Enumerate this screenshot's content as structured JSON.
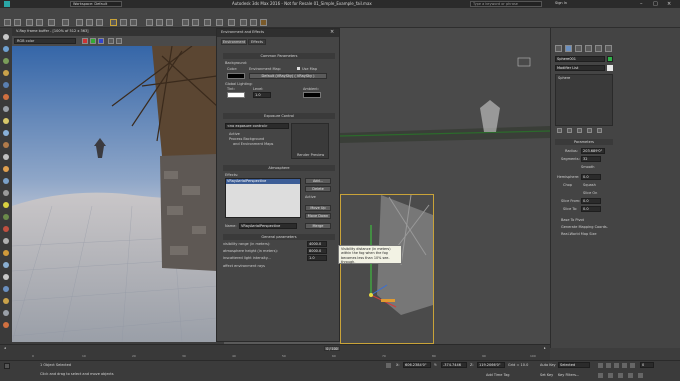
{
  "window": {
    "title": "Autodesk 3ds Max 2016 - Not for Resale    01_Simple_Example_fail.max",
    "workspace": "Workspace: Default",
    "search_placeholder": "Type a keyword or phrase",
    "signin": "Sign In"
  },
  "menu": [
    "Edit",
    "Tools",
    "Group",
    "Views",
    "Create",
    "Modifiers",
    "Animation",
    "Graph Editors",
    "Rendering",
    "Civil View",
    "Customize",
    "Scripting",
    "Help"
  ],
  "frame_buffer": {
    "title": "V-Ray frame buffer - [100% of 512 x 363]",
    "channel": "RGB color"
  },
  "env_dialog": {
    "title": "Environment and Effects",
    "tabs": [
      "Environment",
      "Effects"
    ],
    "common_params": "Common Parameters",
    "background": "Background:",
    "color": "Color:",
    "env_map": "Environment Map:",
    "use_map": "Use Map",
    "map_name": "Default (VRaySky) ( VRaySky )",
    "global_lighting": "Global Lighting:",
    "tint": "Tint:",
    "level": "Level:",
    "level_value": "1.0",
    "ambient": "Ambient:",
    "exposure_hdr": "Exposure Control",
    "exposure_value": "<no exposure control>",
    "active": "Active",
    "process_bg": "Process Background",
    "and_env_maps": "and Environment Maps",
    "render_preview": "Render Preview",
    "atmosphere_hdr": "Atmosphere",
    "effects_label": "Effects:",
    "effect_item": "VRayAerialPerspective",
    "add": "Add...",
    "delete": "Delete",
    "active2": "Active",
    "move_up": "Move Up",
    "move_down": "Move Down",
    "name_label": "Name:",
    "name_value": "VRayAerialPerspective",
    "merge": "Merge",
    "general_params": "General parameters",
    "visibility_range": "visibility range (in meters):",
    "visibility_value": "4000.0",
    "atmosphere_height": "atmosphere height (in meters):",
    "atmosphere_value": "8000.0",
    "inscattered": "inscattered light intensity...",
    "inscattered_value": "1.0",
    "affect_env": "affect environment rays"
  },
  "tooltip": "Visibility distance (in meters) within the fog when the fog becomes less than 10% see-through.",
  "command_panel": {
    "object_name": "Sphere001",
    "modifier_list": "Modifier List",
    "stack_item": "Sphere",
    "parameters": "Parameters",
    "radius_label": "Radius:",
    "radius_value": "203.689'0\"",
    "segments_label": "Segments:",
    "segments_value": "32",
    "smooth": "Smooth",
    "hemisphere_label": "Hemisphere:",
    "hemisphere_value": "0.0",
    "chop": "Chop",
    "squash": "Squash",
    "slice_on": "Slice On",
    "slice_from": "Slice From:",
    "slice_from_value": "0.0",
    "slice_to": "Slice To:",
    "slice_to_value": "0.0",
    "base_to_pivot": "Base To Pivot",
    "gen_mapping": "Generate Mapping Coords.",
    "real_world": "Real-World Map Size"
  },
  "timeline": {
    "frame": "0 / 100",
    "ticks": [
      "0",
      "10",
      "20",
      "30",
      "40",
      "50",
      "60",
      "70",
      "80",
      "90",
      "100"
    ]
  },
  "status": {
    "selected": "1 Object Selected",
    "hint": "Click and drag to select and move objects",
    "x_label": "X:",
    "x_value": "606.2384'0\"",
    "y_label": "Y:",
    "y_value": "-374.7446",
    "z_label": "Z:",
    "z_value": "119.2066'0\"",
    "grid": "Grid = 10.0",
    "auto_key": "Auto Key",
    "selected_dd": "Selected",
    "set_key": "Set Key",
    "key_filters": "Key Filters...",
    "add_time_tag": "Add Time Tag",
    "frame_field": "0"
  },
  "colors": {
    "accent_yellow": "#c9a339",
    "effect_select": "#3c5d96",
    "tooltip_bg": "#f2f2e4"
  }
}
